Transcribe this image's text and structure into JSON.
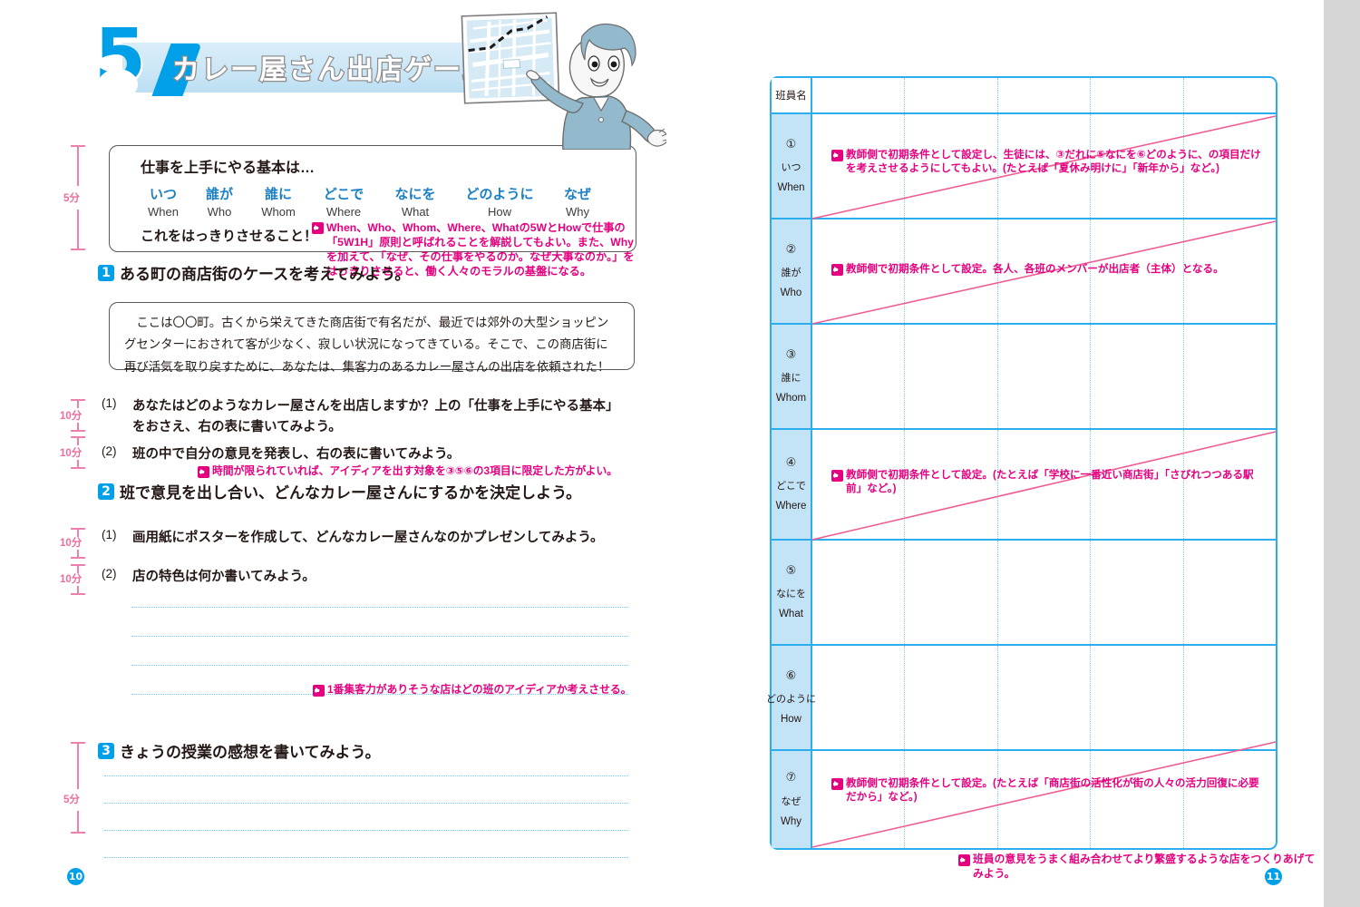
{
  "colors": {
    "accent_blue": "#00a0e9",
    "table_blue": "#2badee",
    "label_fill": "#c3e3f7",
    "annotation_pink": "#e5007f",
    "time_pink": "#ec6d9e",
    "page_bg": "#d6d6d6"
  },
  "left_page": {
    "chapter_number": "5",
    "title": "カレー屋さん出店ゲーム",
    "illustration_name": "boy-pointing-at-city-map",
    "page_number": "10",
    "basics_box": {
      "heading": "仕事を上手にやる基本は…",
      "items": [
        {
          "ja": "いつ",
          "en": "When"
        },
        {
          "ja": "誰が",
          "en": "Who"
        },
        {
          "ja": "誰に",
          "en": "Whom"
        },
        {
          "ja": "どこで",
          "en": "Where"
        },
        {
          "ja": "なにを",
          "en": "What"
        },
        {
          "ja": "どのように",
          "en": "How"
        },
        {
          "ja": "なぜ",
          "en": "Why"
        }
      ],
      "footer": "これをはっきりさせること！"
    },
    "annotation_5w1h": "When、Who、Whom、Where、Whatの5WとHowで仕事の「5W1H」原則と呼ばれることを解説してもよい。また、Whyを加えて、「なぜ、その仕事をやるのか。なぜ大事なのか。」をはっきりさせると、働く人々のモラルの基盤になる。",
    "section1": {
      "badge": "1",
      "title": "ある町の商店街のケースを考えてみよう。",
      "story": "ここは〇〇町。古くから栄えてきた商店街で有名だが、最近では郊外の大型ショッピングセンターにおされて客が少なく、寂しい状況になってきている。そこで、この商店街に再び活気を取り戻すために、あなたは、集客力のあるカレー屋さんの出店を依頼された！",
      "questions": [
        {
          "num": "(1)",
          "text": "あなたはどのようなカレー屋さんを出店しますか？上の「仕事を上手にやる基本」をおさえ、右の表に書いてみよう。",
          "time": "10分"
        },
        {
          "num": "(2)",
          "text": "班の中で自分の意見を発表し、右の表に書いてみよう。",
          "time": "10分"
        }
      ],
      "annotation": "時間が限られていれば、アイディアを出す対象を③⑤⑥の3項目に限定した方がよい。"
    },
    "section2": {
      "badge": "2",
      "title": "班で意見を出し合い、どんなカレー屋さんにするかを決定しよう。",
      "questions": [
        {
          "num": "(1)",
          "text": "画用紙にポスターを作成して、どんなカレー屋さんなのかプレゼンしてみよう。",
          "time": "10分"
        },
        {
          "num": "(2)",
          "text": "店の特色は何か書いてみよう。",
          "time": "10分"
        }
      ],
      "write_lines": 4,
      "annotation": "1番集客力がありそうな店はどの班のアイディアか考えさせる。"
    },
    "section3": {
      "badge": "3",
      "title": "きょうの授業の感想を書いてみよう。",
      "write_lines": 4,
      "time": "5分"
    },
    "time_markers": [
      {
        "label": "5分",
        "section": "basics-box"
      },
      {
        "label": "10分",
        "section": "s1q1"
      },
      {
        "label": "10分",
        "section": "s1q2"
      },
      {
        "label": "10分",
        "section": "s2q1"
      },
      {
        "label": "10分",
        "section": "s2q2"
      },
      {
        "label": "5分",
        "section": "s3"
      }
    ]
  },
  "right_page": {
    "page_number": "11",
    "table": {
      "header_label": "班員名",
      "column_count": 5,
      "rows": [
        {
          "circ": "①",
          "ja": "いつ",
          "en": "When",
          "annotation": "教師側で初期条件として設定し、生徒には、③だれに⑤なにを⑥どのように、の項目だけを考えさせるようにしてもよい。(たとえば「夏休み明けに」「新年から」など。)",
          "has_diagonal": true
        },
        {
          "circ": "②",
          "ja": "誰が",
          "en": "Who",
          "annotation": "教師側で初期条件として設定。各人、各班のメンバーが出店者（主体）となる。",
          "has_diagonal": true
        },
        {
          "circ": "③",
          "ja": "誰に",
          "en": "Whom",
          "annotation": "",
          "has_diagonal": false
        },
        {
          "circ": "④",
          "ja": "どこで",
          "en": "Where",
          "annotation": "教師側で初期条件として設定。(たとえば「学校に一番近い商店街」「さびれつつある駅前」など。)",
          "has_diagonal": true
        },
        {
          "circ": "⑤",
          "ja": "なにを",
          "en": "What",
          "annotation": "",
          "has_diagonal": false
        },
        {
          "circ": "⑥",
          "ja": "どのように",
          "en": "How",
          "annotation": "",
          "has_diagonal": false
        },
        {
          "circ": "⑦",
          "ja": "なぜ",
          "en": "Why",
          "annotation": "教師側で初期条件として設定。(たとえば「商店街の活性化が街の人々の活力回復に必要だから」など。)",
          "has_diagonal": true
        }
      ]
    },
    "annotation_bottom": "班員の意見をうまく組み合わせてより繁盛するような店をつくりあげてみよう。"
  }
}
